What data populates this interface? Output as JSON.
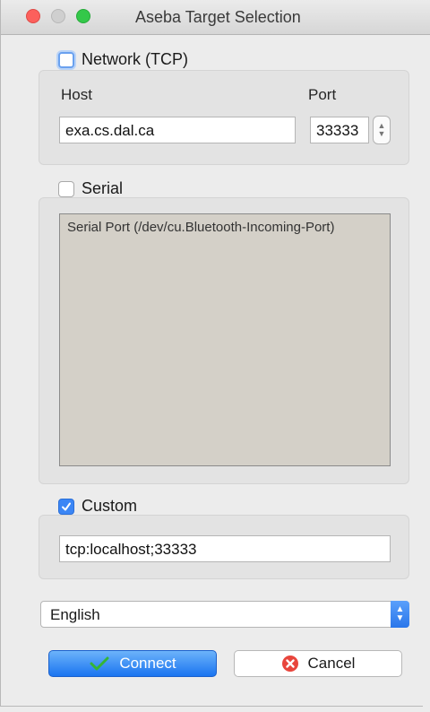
{
  "window": {
    "title": "Aseba Target Selection"
  },
  "network": {
    "label": "Network (TCP)",
    "checked": false,
    "host_label": "Host",
    "port_label": "Port",
    "host_value": "exa.cs.dal.ca",
    "port_value": "33333"
  },
  "serial": {
    "label": "Serial",
    "checked": false,
    "ports": [
      "Serial Port (/dev/cu.Bluetooth-Incoming-Port)"
    ]
  },
  "custom": {
    "label": "Custom",
    "checked": true,
    "target_value": "tcp:localhost;33333"
  },
  "language": {
    "selected": "English"
  },
  "buttons": {
    "connect_label": "Connect",
    "cancel_label": "Cancel"
  },
  "colors": {
    "accent": "#3b86f5",
    "close": "#fc605c",
    "zoom": "#34c84a",
    "cancel_icon": "#e8453c",
    "connect_icon": "#35b535"
  },
  "icons": {
    "connect": "checkmark-icon",
    "cancel": "cancel-x-icon"
  }
}
